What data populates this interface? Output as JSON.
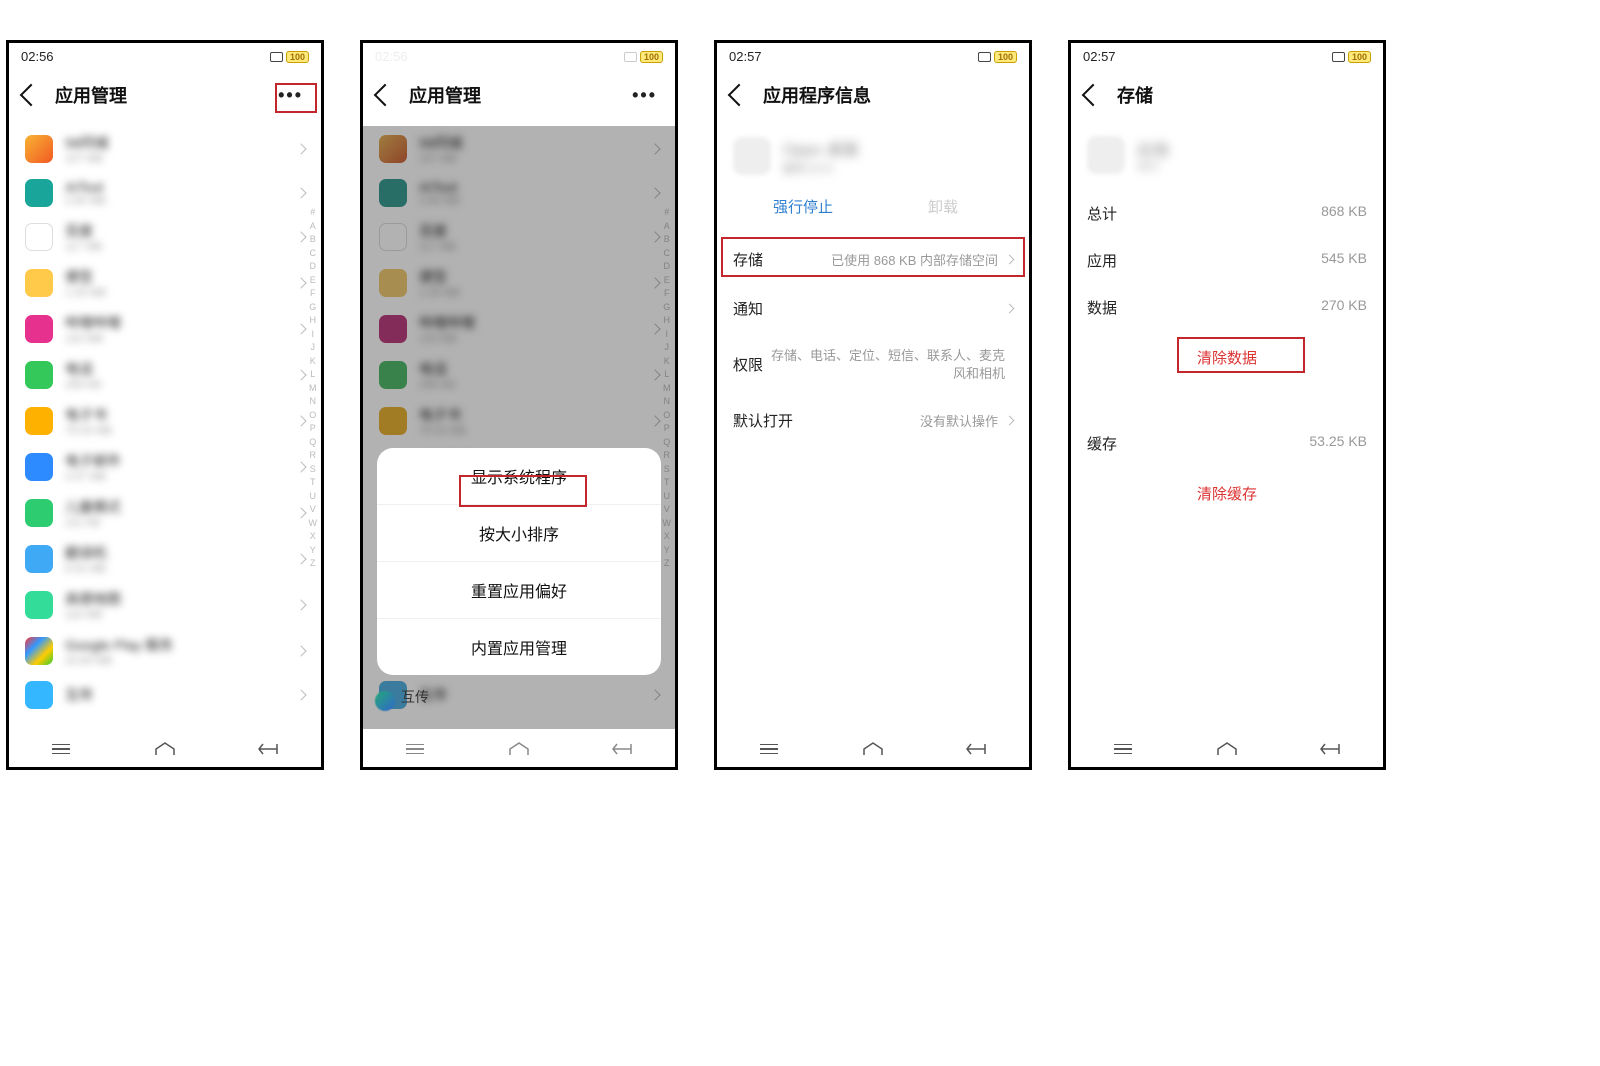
{
  "statusbar": {
    "time_a": "02:56",
    "time_b": "02:57",
    "battery": "100"
  },
  "screen1": {
    "title": "应用管理",
    "apps": [
      {
        "name": "58同城",
        "sub": "107 MB",
        "cls": "c1"
      },
      {
        "name": "AiTool",
        "sub": "2.84 MB",
        "cls": "c2"
      },
      {
        "name": "百度",
        "sub": "117 MB",
        "cls": "c3"
      },
      {
        "name": "便签",
        "sub": "1.34 MB",
        "cls": "c4"
      },
      {
        "name": "哔哩哔哩",
        "sub": "120 MB",
        "cls": "c5"
      },
      {
        "name": "电话",
        "sub": "258 KB",
        "cls": "c6"
      },
      {
        "name": "电子书",
        "sub": "79.43 MB",
        "cls": "c7"
      },
      {
        "name": "电子邮件",
        "sub": "3.47 MB",
        "cls": "c8"
      },
      {
        "name": "儿童模式",
        "sub": "211 KB",
        "cls": "c9"
      },
      {
        "name": "翻译机",
        "sub": "6.52 MB",
        "cls": "c10"
      },
      {
        "name": "高德地图",
        "sub": "116 MB",
        "cls": "c11"
      },
      {
        "name": "Google Play 服务",
        "sub": "20.84 MB",
        "cls": "c12"
      },
      {
        "name": "互传",
        "sub": "",
        "cls": "c13"
      }
    ],
    "alpha": [
      "#",
      "A",
      "B",
      "C",
      "D",
      "E",
      "F",
      "G",
      "H",
      "I",
      "J",
      "K",
      "L",
      "M",
      "N",
      "O",
      "P",
      "Q",
      "R",
      "S",
      "T",
      "U",
      "V",
      "W",
      "X",
      "Y",
      "Z"
    ]
  },
  "screen2": {
    "title": "应用管理",
    "sheet": [
      "显示系统程序",
      "按大小排序",
      "重置应用偏好",
      "内置应用管理"
    ],
    "behind_item": "互传"
  },
  "screen3": {
    "title": "应用程序信息",
    "force_stop": "强行停止",
    "uninstall": "卸载",
    "rows": {
      "storage_label": "存储",
      "storage_value": "已使用 868 KB 内部存储空间",
      "notif_label": "通知",
      "perm_label": "权限",
      "perm_value": "存储、电话、定位、短信、联系人、麦克风和相机",
      "default_label": "默认打开",
      "default_value": "没有默认操作"
    }
  },
  "screen4": {
    "title": "存储",
    "total_label": "总计",
    "total_value": "868 KB",
    "app_label": "应用",
    "app_value": "545 KB",
    "data_label": "数据",
    "data_value": "270 KB",
    "clear_data": "清除数据",
    "cache_label": "缓存",
    "cache_value": "53.25 KB",
    "clear_cache": "清除缓存"
  }
}
